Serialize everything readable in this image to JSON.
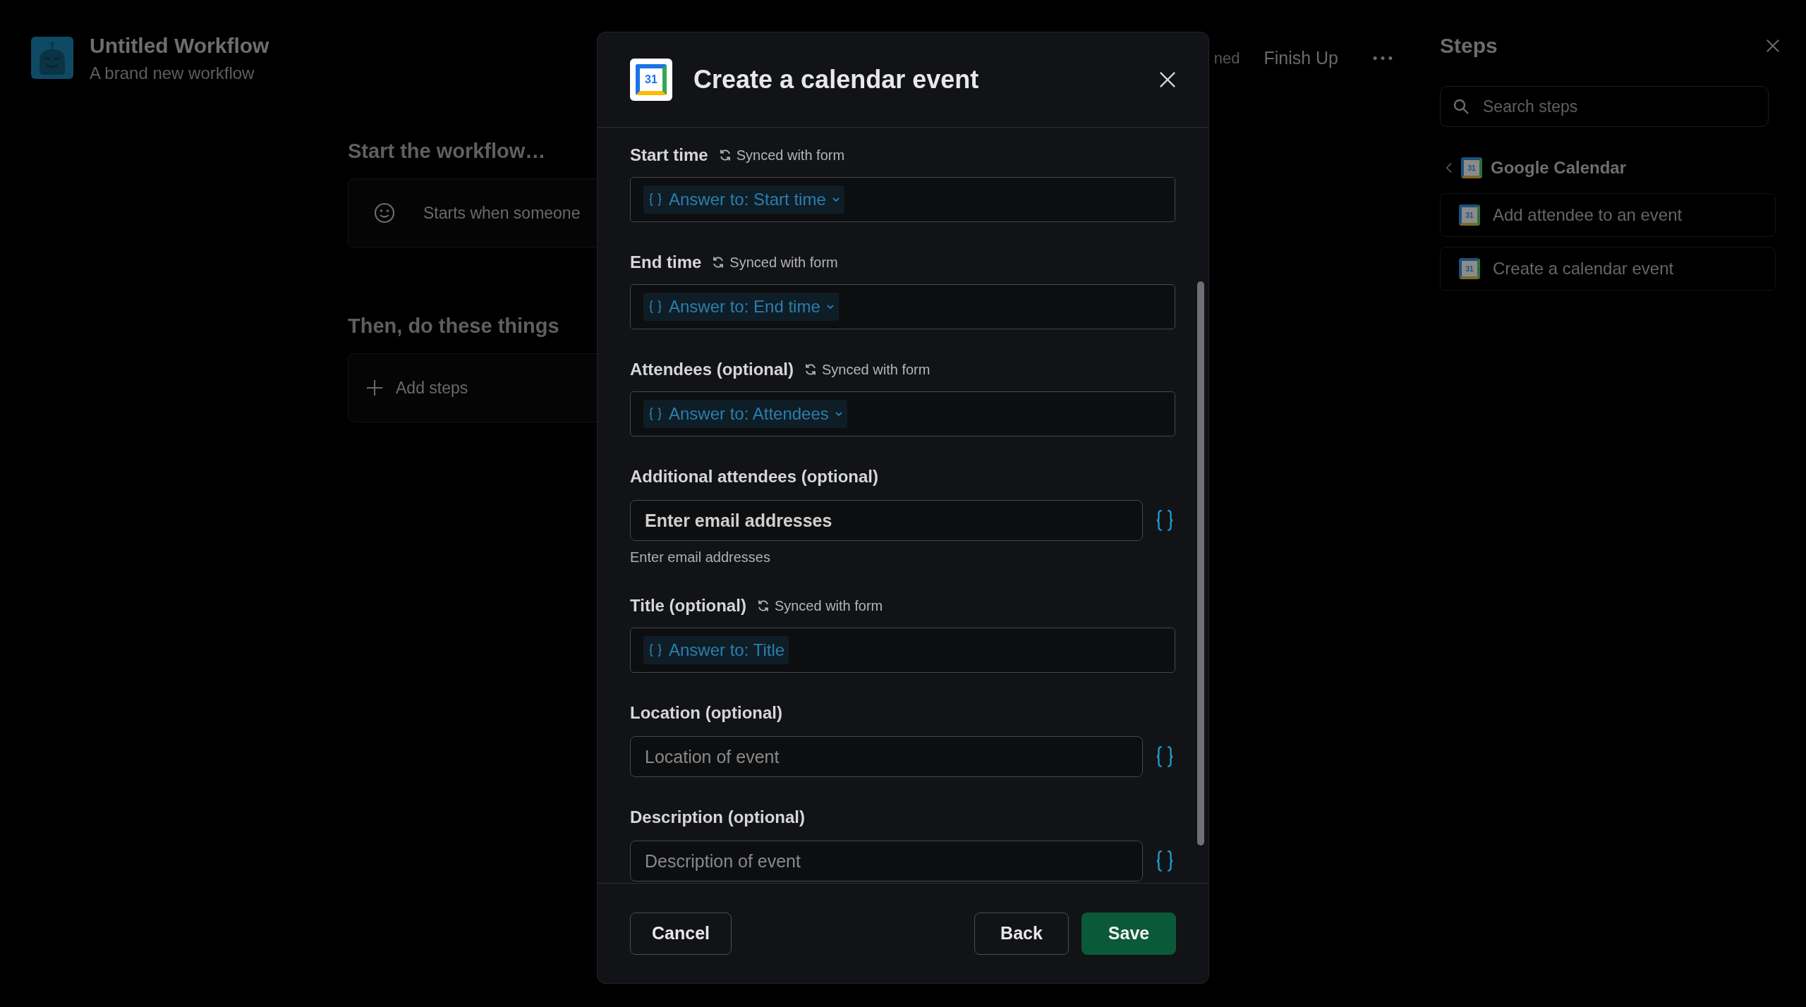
{
  "workflow": {
    "title": "Untitled Workflow",
    "subtitle": "A brand new workflow"
  },
  "canvas": {
    "sections": [
      {
        "heading": "Start the workflow…",
        "card": {
          "kind": "trigger",
          "text": "Starts when someone"
        }
      },
      {
        "heading": "Then, do these things",
        "card": {
          "kind": "add",
          "text": "Add steps"
        }
      }
    ]
  },
  "toolbar": {
    "items": [
      "ned",
      "Finish Up"
    ]
  },
  "steps_panel": {
    "title": "Steps",
    "search": {
      "placeholder": "Search steps"
    },
    "group": {
      "name": "Google Calendar",
      "icon_text": "31"
    },
    "items": [
      {
        "label": "Add attendee to an event",
        "icon_text": "31"
      },
      {
        "label": "Create a calendar event",
        "icon_text": "31"
      }
    ]
  },
  "dialog": {
    "title": "Create a calendar event",
    "icon_text": "31",
    "fields": [
      {
        "kind": "token",
        "label": "Start time",
        "sync_note": "Synced with form",
        "token": "Answer to: Start time",
        "dropdown": true
      },
      {
        "kind": "token",
        "label": "End time",
        "sync_note": "Synced with form",
        "token": "Answer to: End time",
        "dropdown": true
      },
      {
        "kind": "token",
        "label": "Attendees (optional)",
        "sync_note": "Synced with form",
        "token": "Answer to: Attendees",
        "dropdown": true
      },
      {
        "kind": "input",
        "label": "Additional attendees (optional)",
        "value": "Enter email addresses",
        "hint": "Enter email addresses"
      },
      {
        "kind": "token",
        "label": "Title (optional)",
        "sync_note": "Synced with form",
        "token": "Answer to: Title",
        "dropdown": false
      },
      {
        "kind": "input",
        "label": "Location (optional)",
        "placeholder": "Location of event"
      },
      {
        "kind": "input",
        "label": "Description (optional)",
        "placeholder": "Description of event"
      }
    ],
    "buttons": [
      {
        "label": "Cancel",
        "kind": "secondary"
      },
      {
        "label": "Back",
        "kind": "secondary"
      },
      {
        "label": "Save",
        "kind": "primary"
      }
    ]
  }
}
